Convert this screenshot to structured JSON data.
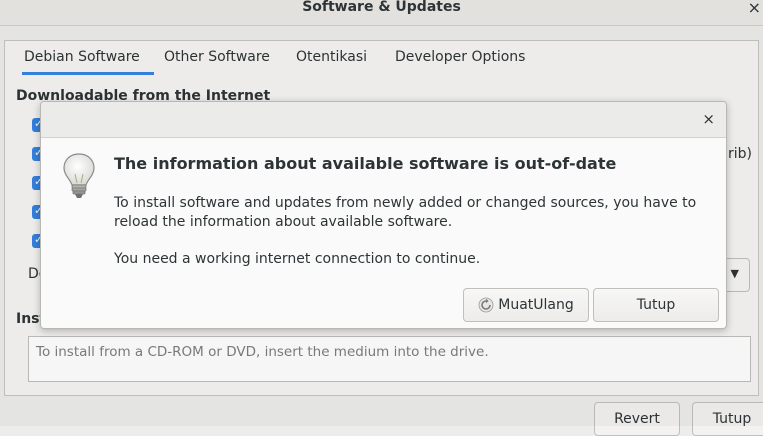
{
  "window": {
    "title": "Software & Updates",
    "close_glyph": "×"
  },
  "tabs": [
    {
      "label": "Debian Software",
      "active": true
    },
    {
      "label": "Other Software",
      "active": false
    },
    {
      "label": "Otentikasi",
      "active": false
    },
    {
      "label": "Developer Options",
      "active": false
    }
  ],
  "background": {
    "section_heading": "Downloadable from the Internet",
    "right_fragment": "rib)",
    "left_fragment_de": "De",
    "left_fragment_inst": "Inst",
    "cd_placeholder": "To install from a CD-ROM or DVD, insert the medium into the drive.",
    "revert_label": "Revert",
    "close_label": "Tutup"
  },
  "dialog": {
    "close_glyph": "×",
    "icon": "lightbulb-icon",
    "title": "The information about available software is out-of-date",
    "body": "To install software and updates from newly added or changed sources, you have to reload the information about available software.",
    "note": "You need a working internet connection to continue.",
    "reload_label": "MuatUlang",
    "close_label": "Tutup"
  },
  "colors": {
    "accent": "#3584e4",
    "dialog_bg": "#fafafa",
    "window_bg": "#ededec"
  }
}
